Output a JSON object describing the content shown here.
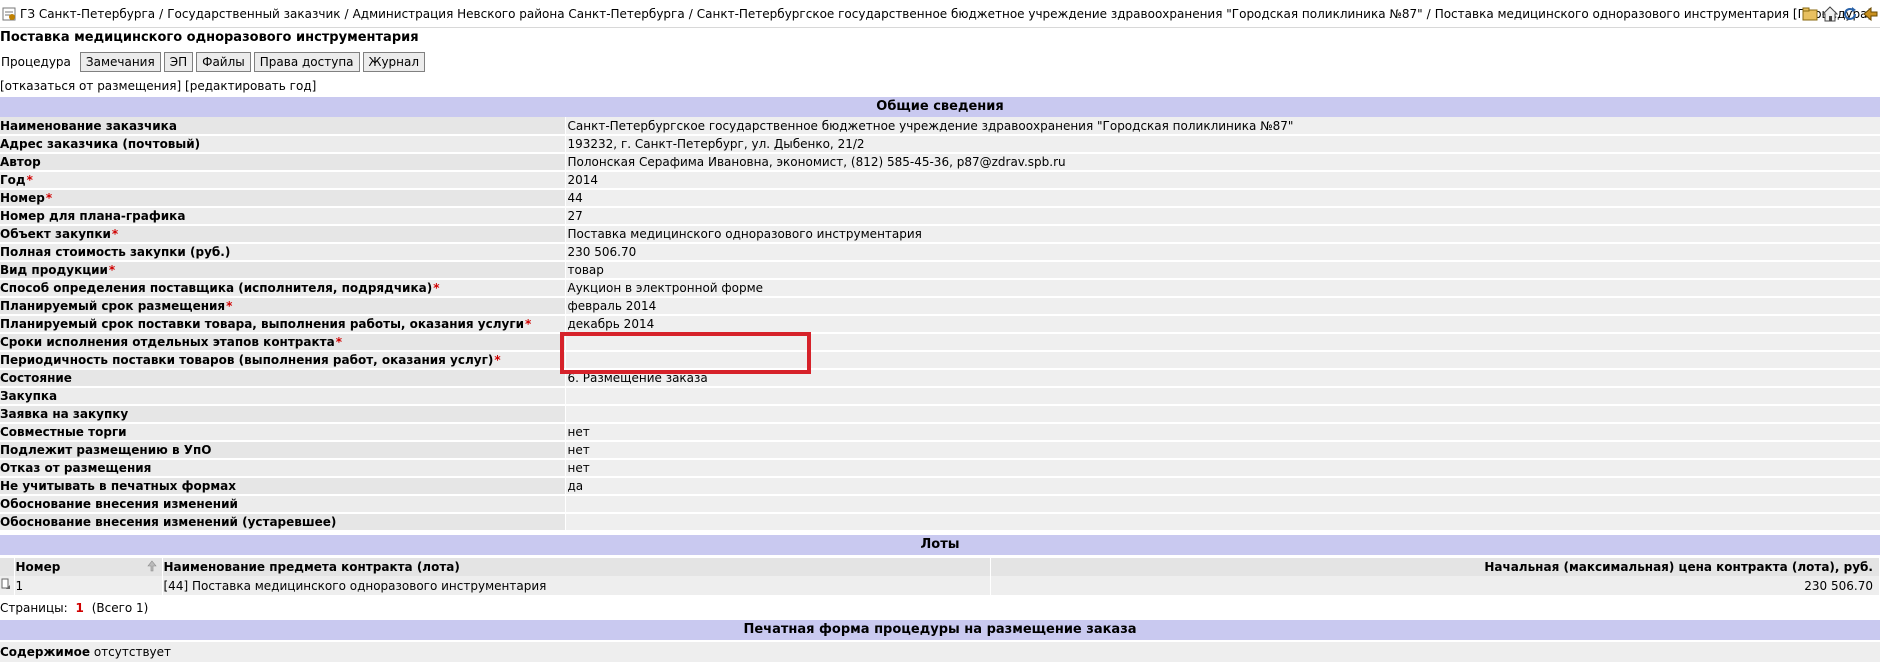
{
  "breadcrumb": {
    "items": [
      "ГЗ Санкт-Петербурга",
      "Государственный заказчик",
      "Администрация Невского района Санкт-Петербурга",
      "Санкт-Петербургское государственное бюджетное учреждение здравоохранения \"Городская поликлиника №87\"",
      "Поставка медицинского одноразового инструментария [Процедура]"
    ],
    "separator": "/"
  },
  "toolbar_icons": [
    "folder-icon",
    "home-icon",
    "refresh-icon",
    "back-icon"
  ],
  "page_title": "Поставка медицинского одноразового инструментария",
  "tabs": [
    "Процедура",
    "Замечания",
    "ЭП",
    "Файлы",
    "Права доступа",
    "Журнал"
  ],
  "actions": [
    "[отказаться от размещения]",
    "[редактировать год]"
  ],
  "general": {
    "header": "Общие сведения",
    "required_mark": "*",
    "rows": [
      {
        "label": "Наименование заказчика",
        "value": "Санкт-Петербургское государственное бюджетное учреждение здравоохранения \"Городская поликлиника №87\"",
        "required": false
      },
      {
        "label": "Адрес заказчика (почтовый)",
        "value": "193232, г. Санкт-Петербург, ул. Дыбенко, 21/2",
        "required": false
      },
      {
        "label": "Автор",
        "value": "Полонская Серафима Ивановна, экономист, (812) 585-45-36, p87@zdrav.spb.ru",
        "required": false
      },
      {
        "label": "Год",
        "value": "2014",
        "required": true
      },
      {
        "label": "Номер",
        "value": "44",
        "required": true
      },
      {
        "label": "Номер для плана-графика",
        "value": "27",
        "required": false
      },
      {
        "label": "Объект закупки",
        "value": "Поставка медицинского одноразового инструментария",
        "required": true
      },
      {
        "label": "Полная стоимость закупки (руб.)",
        "value": "230 506.70",
        "required": false
      },
      {
        "label": "Вид продукции",
        "value": "товар",
        "required": true
      },
      {
        "label": "Способ определения поставщика (исполнителя, подрядчика)",
        "value": "Аукцион в электронной форме",
        "required": true
      },
      {
        "label": "Планируемый срок размещения",
        "value": "февраль 2014",
        "required": true
      },
      {
        "label": "Планируемый срок поставки товара, выполнения работы, оказания услуги",
        "value": "декабрь 2014",
        "required": true
      },
      {
        "label": "Сроки исполнения отдельных этапов контракта",
        "value": "",
        "required": true
      },
      {
        "label": "Периодичность поставки товаров (выполнения работ, оказания услуг)",
        "value": "",
        "required": true
      },
      {
        "label": "Состояние",
        "value": "6. Размещение заказа",
        "required": false
      },
      {
        "label": "Закупка",
        "value": "",
        "required": false
      },
      {
        "label": "Заявка на закупку",
        "value": "",
        "required": false
      },
      {
        "label": "Совместные торги",
        "value": "нет",
        "required": false
      },
      {
        "label": "Подлежит размещению в УпО",
        "value": "нет",
        "required": false
      },
      {
        "label": "Отказ от размещения",
        "value": "нет",
        "required": false
      },
      {
        "label": "Не учитывать в печатных формах",
        "value": "да",
        "required": false
      },
      {
        "label": "Обоснование внесения изменений",
        "value": "",
        "required": false
      },
      {
        "label": "Обоснование внесения изменений (устаревшее)",
        "value": "",
        "required": false
      }
    ]
  },
  "lots": {
    "header": "Лоты",
    "columns": [
      "Номер",
      "Наименование предмета контракта (лота)",
      "Начальная (максимальная) цена контракта (лота), руб."
    ],
    "rows": [
      {
        "number": "1",
        "name": "[44] Поставка медицинского одноразового инструментария",
        "price": "230 506.70"
      }
    ]
  },
  "pager": {
    "label": "Страницы:",
    "current": "1",
    "total": "(Всего 1)"
  },
  "print_form": {
    "header": "Печатная форма процедуры на размещение заказа",
    "label": "Содержимое",
    "value": "отсутствует"
  },
  "colors": {
    "section_header_bg": "#c9c9f0",
    "required": "#d00000",
    "highlight": "#d6222a"
  }
}
